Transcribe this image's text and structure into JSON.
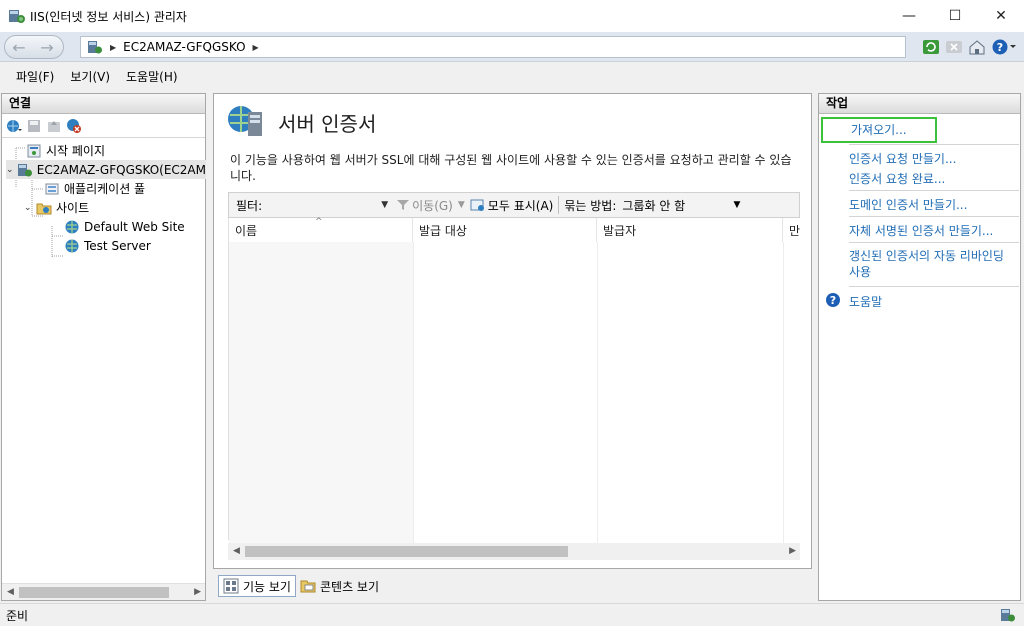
{
  "window": {
    "title": "IIS(인터넷 정보 서비스) 관리자",
    "minimize_glyph": "—",
    "maximize_glyph": "☐",
    "close_glyph": "✕"
  },
  "address": {
    "crumb": "EC2AMAZ-GFQGSKO"
  },
  "menu": [
    "파일(F)",
    "보기(V)",
    "도움말(H)"
  ],
  "connections": {
    "header": "연결",
    "tree": {
      "start_page": "시작 페이지",
      "server": "EC2AMAZ-GFQGSKO(EC2AM",
      "app_pools": "애플리케이션 풀",
      "sites": "사이트",
      "site1": "Default Web Site",
      "site2": "Test Server"
    }
  },
  "main": {
    "title": "서버 인증서",
    "description": "이 기능을 사용하여 웹 서버가 SSL에 대해 구성된 웹 사이트에 사용할 수 있는 인증서를 요청하고 관리할 수 있습니다.",
    "filter": {
      "label": "필터:",
      "go_label": "이동(G)",
      "show_all_label": "모두 표시(A)",
      "group_label": "묶는 방법:",
      "group_value": "그룹화 안 함"
    },
    "columns": [
      "이름",
      "발급 대상",
      "발급자",
      "만"
    ],
    "view_tabs": {
      "features": "기능 보기",
      "content": "콘텐츠 보기"
    }
  },
  "actions": {
    "header": "작업",
    "items": {
      "import": "가져오기...",
      "create_request": "인증서 요청 만들기...",
      "complete_request": "인증서 요청 완료...",
      "create_domain": "도메인 인증서 만들기...",
      "create_self_signed": "자체 서명된 인증서 만들기...",
      "auto_rebind": "갱신된 인증서의 자동 리바인딩 사용",
      "help": "도움말"
    }
  },
  "status": {
    "text": "준비"
  },
  "colors": {
    "link": "#1f6cb5",
    "highlight": "#3cc13c"
  }
}
